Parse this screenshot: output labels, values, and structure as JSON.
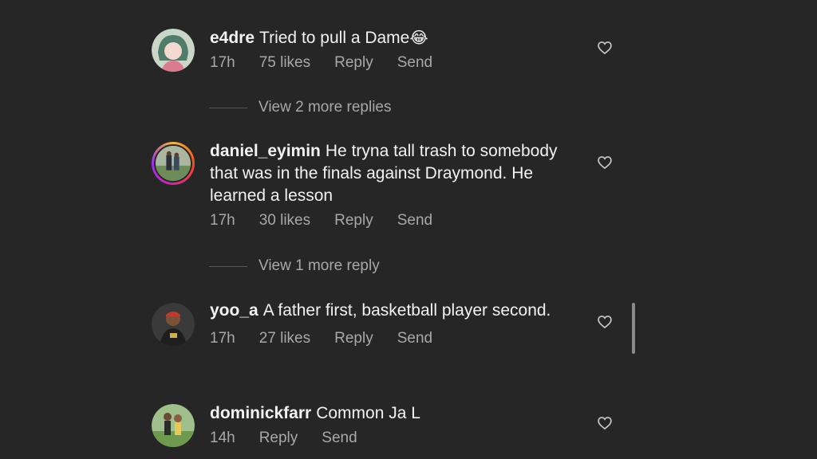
{
  "comments": [
    {
      "username": "e4dre",
      "text": "Tried to pull a Dame",
      "emoji": "😂",
      "time": "17h",
      "likes": "75 likes",
      "reply": "Reply",
      "send": "Send",
      "view_more": "View 2 more replies"
    },
    {
      "username": "daniel_eyimin",
      "text": "He tryna tall trash to somebody that was in the finals against Draymond. He learned a lesson",
      "time": "17h",
      "likes": "30 likes",
      "reply": "Reply",
      "send": "Send",
      "view_more": "View 1 more reply"
    },
    {
      "username": "yoo_a",
      "text": "A father first, basketball player second.",
      "time": "17h",
      "likes": "27 likes",
      "reply": "Reply",
      "send": "Send"
    },
    {
      "username": "dominickfarr",
      "text": "Common Ja L",
      "time": "14h",
      "reply": "Reply",
      "send": "Send"
    }
  ],
  "icons": {
    "like": "heart-outline-icon"
  },
  "colors": {
    "background": "#262626",
    "muted": "#a8a8a8",
    "text": "#f2f2f2"
  }
}
